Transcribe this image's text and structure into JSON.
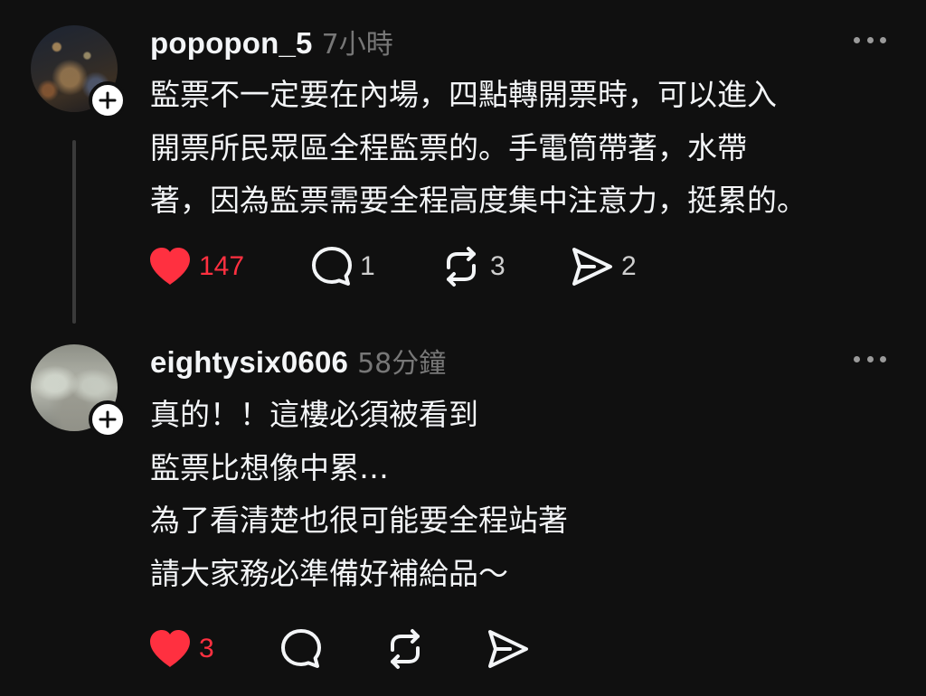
{
  "posts": [
    {
      "username": "popopon_5",
      "time": "7小時",
      "lines": [
        "監票不一定要在內場，四點轉開票時，可以進入",
        "開票所民眾區全程監票的。手電筒帶著，水帶",
        "著，因為監票需要全程高度集中注意力，挺累的。"
      ],
      "likes": "147",
      "comments": "1",
      "reposts": "3",
      "shares": "2",
      "liked": true
    },
    {
      "username": "eightysix0606",
      "time": "58分鐘",
      "lines": [
        "真的！！這樓必須被看到",
        "監票比想像中累…",
        "為了看清楚也很可能要全程站著",
        "請大家務必準備好補給品～"
      ],
      "likes": "3",
      "liked": true
    }
  ],
  "icons": {
    "like": "heart-icon",
    "comment": "comment-bubble-icon",
    "repost": "repost-icon",
    "share": "send-icon",
    "more": "more-horizontal-icon",
    "follow": "plus-icon"
  },
  "colors": {
    "background": "#101010",
    "text": "#f3f5f7",
    "secondary": "#777777",
    "like": "#ff3040"
  }
}
